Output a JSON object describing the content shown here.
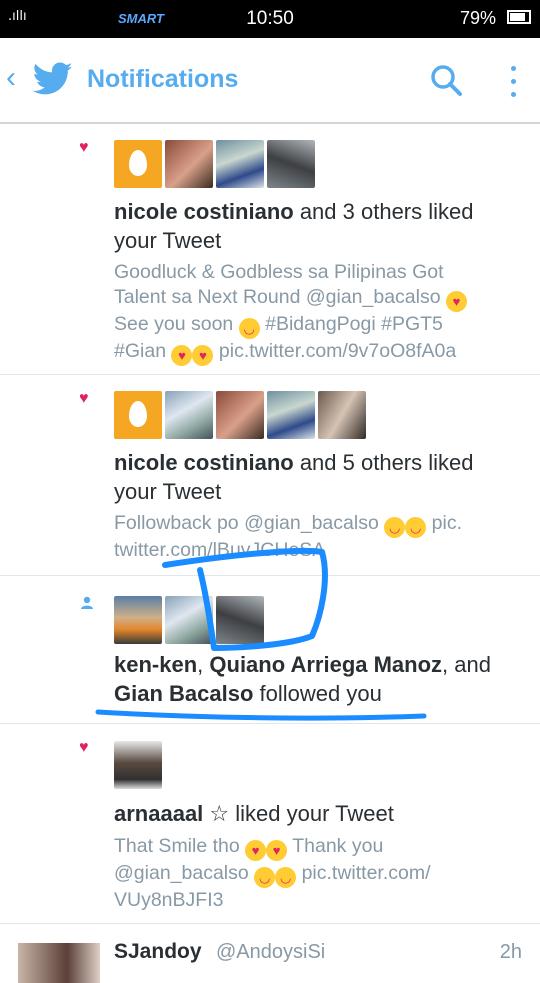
{
  "status_bar": {
    "signal": ".ıllı",
    "carrier": "SMART",
    "time": "10:50",
    "battery": "79%"
  },
  "header": {
    "title": "Notifications",
    "icons": [
      "back-chevron",
      "twitter-bird",
      "search-icon",
      "overflow-menu-icon"
    ]
  },
  "notifications": [
    {
      "kind": "like",
      "actor": "nicole costiniano",
      "rest_line1": " and 3 others liked",
      "line2": "your Tweet",
      "tweet": [
        "Goodluck & Godbless sa Pilipinas Got",
        "Talent sa Next Round @gian_bacalso",
        "See you soon",
        "#BidangPogi #PGT5",
        "#Gian",
        "pic.twitter.com/9v7oO8fA0a"
      ]
    },
    {
      "kind": "like",
      "actor": "nicole costiniano",
      "rest_line1": " and 5 others liked",
      "line2": "your Tweet",
      "tweet": [
        "Followback po @gian_bacalso",
        "pic.",
        "twitter.com/lBuvJCHeSA"
      ]
    },
    {
      "kind": "follow",
      "actor1": "ken-ken",
      "sep1": ", ",
      "actor2": "Quiano Arriega Manoz",
      "sep2": ", and",
      "actor3": "Gian Bacalso",
      "rest": " followed you"
    },
    {
      "kind": "like",
      "actor": "arnaaaal",
      "star": "☆",
      "rest_line1": " liked your Tweet",
      "tweet": [
        "That Smile tho",
        "Thank you",
        "@gian_bacalso",
        "pic.twitter.com/",
        "VUy8nBJFI3"
      ]
    }
  ],
  "last_tweet": {
    "name": "SJandoy",
    "handle": "@AndoysiSi",
    "time": "2h"
  },
  "colors": {
    "accent": "#55acee",
    "like": "#e0245e",
    "annotation": "#1a8cff"
  }
}
